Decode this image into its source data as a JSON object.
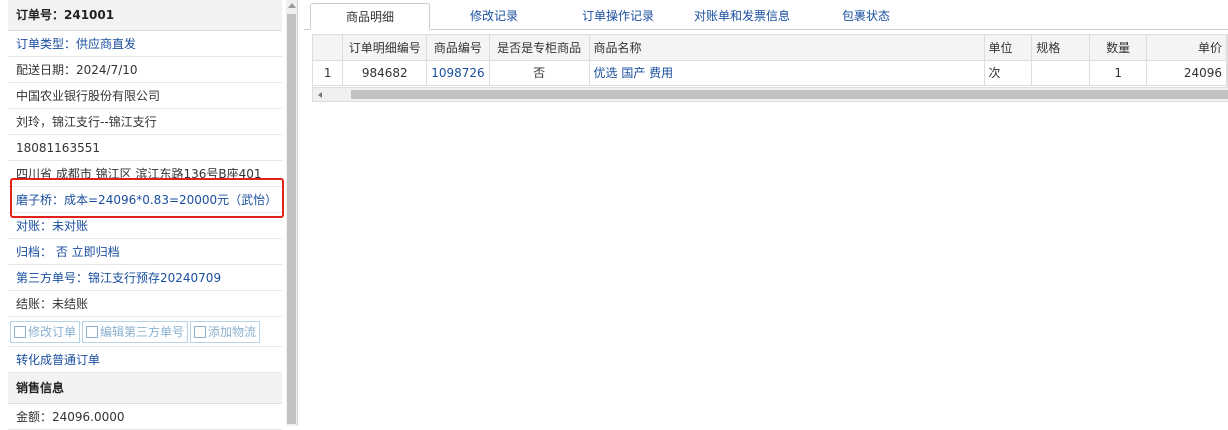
{
  "order_panel": {
    "title": "订单号：241001",
    "order_type": "订单类型：供应商直发",
    "delivery_date": "配送日期：2024/7/10",
    "company": "中国农业银行股份有限公司",
    "contact": "刘玲，锦江支行--锦江支行",
    "phone": "18081163551",
    "address": "四川省 成都市 锦江区 滨江东路136号B座401",
    "cost_note": "磨子桥：成本=24096*0.83=20000元（武怡）",
    "reconcile": "对账：未对账",
    "archive": "归档：  否 立即归档",
    "third_party_no": "第三方单号：锦江支行预存20240709",
    "settlement": "结账：未结账",
    "buttons": {
      "edit_order": "修改订单",
      "edit_third_party": "编辑第三方单号",
      "add_logistics": "添加物流"
    },
    "convert": "转化成普通订单",
    "sales_section": "销售信息",
    "amount": "金额：24096.0000"
  },
  "tabs": [
    "商品明细",
    "修改记录",
    "订单操作记录",
    "对账单和发票信息",
    "包裹状态"
  ],
  "table": {
    "headers": [
      "",
      "订单明细编号",
      "商品编号",
      "是否是专柜商品",
      "商品名称",
      "单位",
      "规格",
      "数量",
      "单价"
    ],
    "rows": [
      [
        "1",
        "984682",
        "1098726",
        "否",
        "优选 国产 费用",
        "次",
        "",
        "1",
        "24096"
      ]
    ]
  },
  "colors": {
    "link": "#1a4fa0",
    "highlight_border": "#e0221a"
  }
}
